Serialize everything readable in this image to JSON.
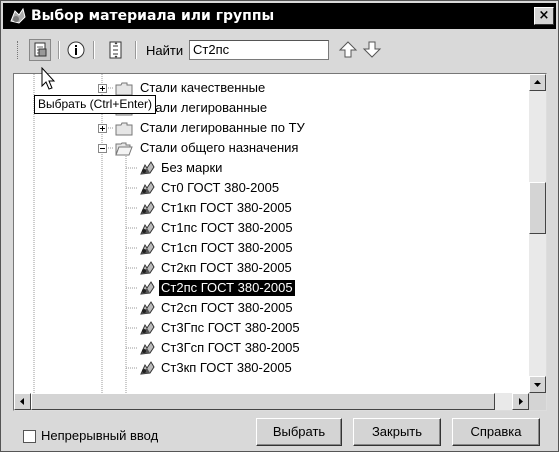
{
  "window": {
    "title": "Выбор материала или группы",
    "close_label": "×"
  },
  "toolbar": {
    "find_label": "Найти",
    "find_value": "Ст2пс",
    "select_tooltip": "Выбрать (Ctrl+Enter)"
  },
  "tree": {
    "items": [
      {
        "label": "Стали качественные",
        "kind": "group",
        "expander": "plus"
      },
      {
        "label": "Стали легированные",
        "kind": "group",
        "expander": "plus"
      },
      {
        "label": "Стали легированные по ТУ",
        "kind": "group",
        "expander": "plus"
      },
      {
        "label": "Стали общего назначения",
        "kind": "group",
        "expander": "minus"
      },
      {
        "label": "Без марки",
        "kind": "material"
      },
      {
        "label": "Ст0 ГОСТ 380-2005",
        "kind": "material"
      },
      {
        "label": "Ст1кп ГОСТ 380-2005",
        "kind": "material"
      },
      {
        "label": "Ст1пс ГОСТ 380-2005",
        "kind": "material"
      },
      {
        "label": "Ст1сп ГОСТ 380-2005",
        "kind": "material"
      },
      {
        "label": "Ст2кп ГОСТ 380-2005",
        "kind": "material"
      },
      {
        "label": "Ст2пс ГОСТ 380-2005",
        "kind": "material",
        "selected": true
      },
      {
        "label": "Ст2сп ГОСТ 380-2005",
        "kind": "material"
      },
      {
        "label": "Ст3Гпс ГОСТ 380-2005",
        "kind": "material"
      },
      {
        "label": "Ст3Гсп ГОСТ 380-2005",
        "kind": "material"
      },
      {
        "label": "Ст3кп ГОСТ 380-2005",
        "kind": "material"
      }
    ]
  },
  "footer": {
    "continuous_label": "Непрерывный ввод",
    "continuous_checked": false,
    "select_button": "Выбрать",
    "close_button": "Закрыть",
    "help_button": "Справка"
  },
  "icons": {
    "title": "material-window-icon",
    "select": "select-icon",
    "info": "info-icon",
    "tree": "tree-view-icon",
    "find_up": "arrow-up-icon",
    "find_down": "arrow-down-icon",
    "folder": "folder-icon",
    "material": "material-icon"
  },
  "colors": {
    "title_bg": "#000000",
    "selection_bg": "#000000",
    "window_bg": "#d9d9d9"
  }
}
